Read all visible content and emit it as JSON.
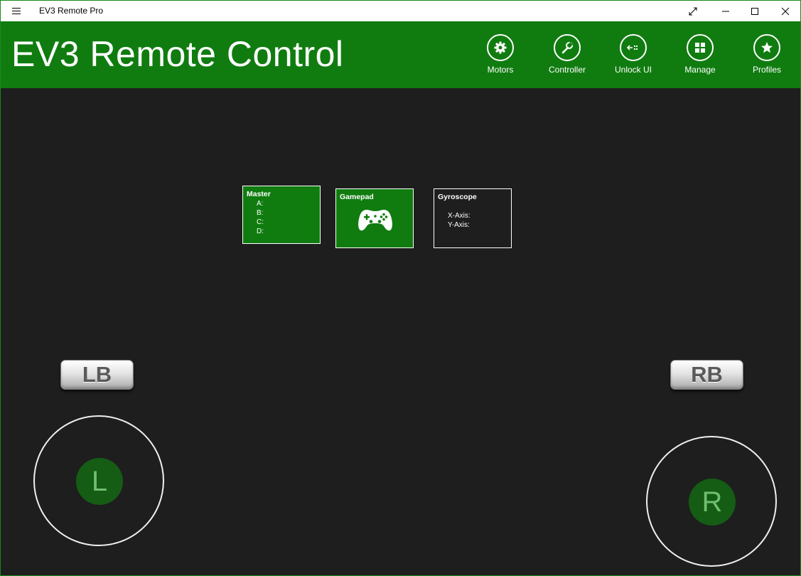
{
  "window": {
    "title": "EV3 Remote Pro",
    "controls": [
      "expand-icon",
      "minimize-icon",
      "maximize-icon",
      "close-icon"
    ]
  },
  "header": {
    "title": "EV3 Remote Control",
    "color": "#107c10",
    "buttons": [
      {
        "label": "Motors",
        "icon": "gear-icon"
      },
      {
        "label": "Controller",
        "icon": "wrench-icon"
      },
      {
        "label": "Unlock UI",
        "icon": "unlock-icon"
      },
      {
        "label": "Manage",
        "icon": "grid-icon"
      },
      {
        "label": "Profiles",
        "icon": "star-icon"
      }
    ]
  },
  "tiles": {
    "master": {
      "title": "Master",
      "lines": [
        "A:",
        "B:",
        "C:",
        "D:"
      ]
    },
    "gamepad": {
      "title": "Gamepad",
      "icon": "gamepad-icon"
    },
    "gyroscope": {
      "title": "Gyroscope",
      "lines": [
        "X-Axis:",
        "Y-Axis:"
      ]
    }
  },
  "shoulders": {
    "left": "LB",
    "right": "RB"
  },
  "joysticks": {
    "left": "L",
    "right": "R"
  }
}
